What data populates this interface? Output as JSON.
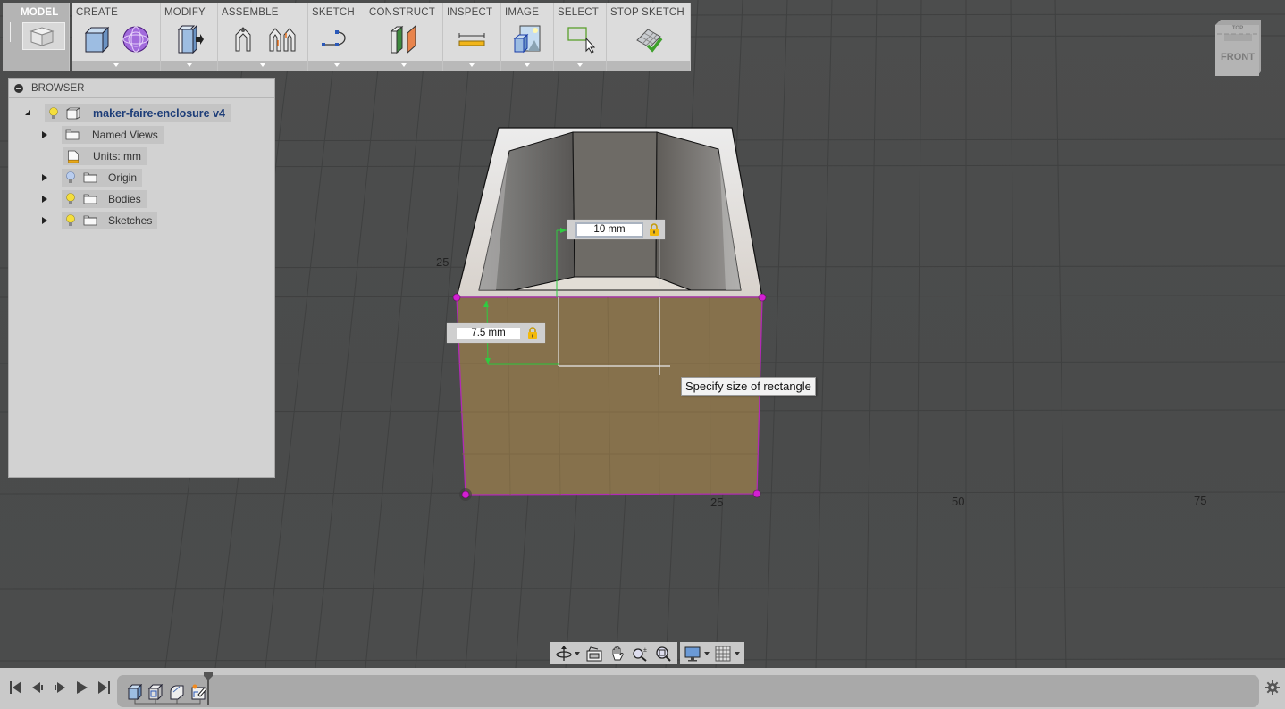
{
  "toolbar": {
    "workspace": "MODEL",
    "groups": [
      {
        "label": "CREATE",
        "icons": [
          "box-icon",
          "sphere-icon"
        ]
      },
      {
        "label": "MODIFY",
        "icons": [
          "press-pull-icon"
        ]
      },
      {
        "label": "ASSEMBLE",
        "icons": [
          "joint-icon",
          "as-built-joint-icon"
        ]
      },
      {
        "label": "SKETCH",
        "icons": [
          "spline-icon"
        ]
      },
      {
        "label": "CONSTRUCT",
        "icons": [
          "offset-plane-icon"
        ]
      },
      {
        "label": "INSPECT",
        "icons": [
          "measure-icon"
        ]
      },
      {
        "label": "IMAGE",
        "icons": [
          "render-image-icon"
        ]
      },
      {
        "label": "SELECT",
        "icons": [
          "window-select-icon"
        ]
      },
      {
        "label": "STOP SKETCH",
        "icons": [
          "stop-sketch-icon"
        ]
      }
    ]
  },
  "browser": {
    "title": "BROWSER",
    "root": "maker-faire-enclosure v4",
    "items": [
      {
        "label": "Named Views",
        "expandable": true,
        "bulb": null
      },
      {
        "label": "Units: mm",
        "expandable": false,
        "bulb": null
      },
      {
        "label": "Origin",
        "expandable": true,
        "bulb": "off"
      },
      {
        "label": "Bodies",
        "expandable": true,
        "bulb": "on"
      },
      {
        "label": "Sketches",
        "expandable": true,
        "bulb": "on"
      }
    ]
  },
  "viewcube": {
    "top": "TOP",
    "front": "FRONT"
  },
  "sketch": {
    "width_dim": "10 mm",
    "height_dim": "7.5 mm",
    "tooltip": "Specify size of rectangle",
    "colors": {
      "face": "#86714c",
      "sketch_line": "#b12ab5",
      "dim_arrow": "#2ecc40",
      "point": "#d21fd2"
    }
  },
  "axis_labels": {
    "v25": "25",
    "h25": "25",
    "h50": "50",
    "h75": "75"
  },
  "navbar": {
    "icons": [
      "orbit-icon",
      "look-at-icon",
      "pan-icon",
      "zoom-icon",
      "fit-icon",
      "display-settings-icon",
      "grid-settings-icon"
    ]
  },
  "timeline": {
    "controls": [
      "go-to-start",
      "step-back",
      "step-forward",
      "play",
      "go-to-end"
    ],
    "features": [
      "extrude-feature",
      "shell-feature",
      "fillet-feature",
      "sketch-feature"
    ]
  }
}
